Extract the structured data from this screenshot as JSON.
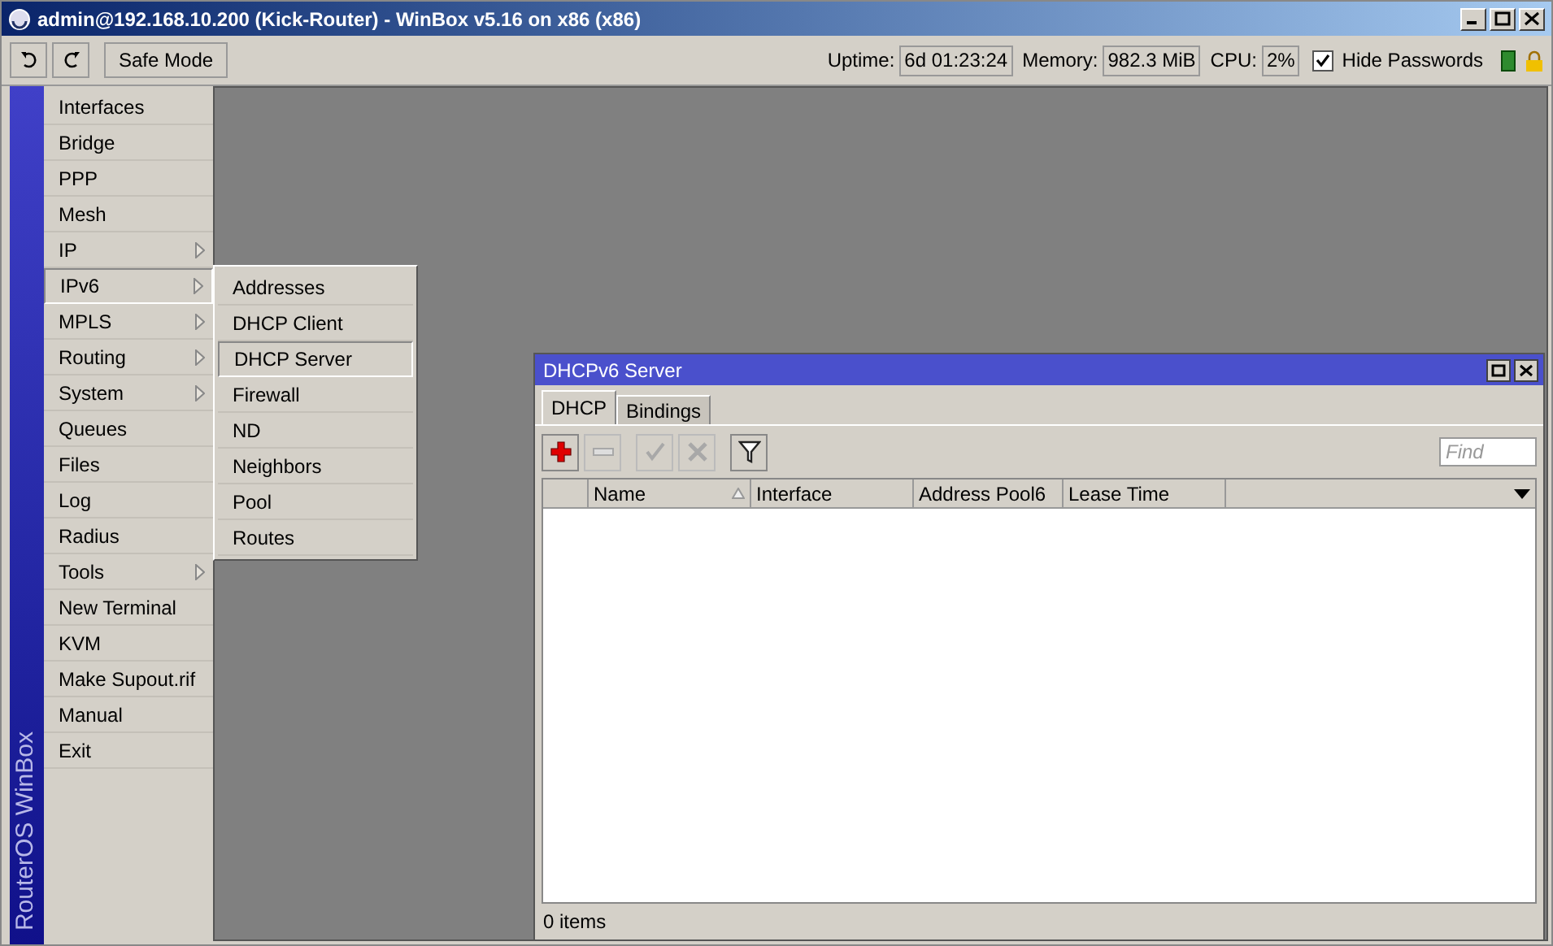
{
  "window": {
    "title": "admin@192.168.10.200 (Kick-Router) - WinBox v5.16 on x86 (x86)"
  },
  "toolbar": {
    "safe_mode": {
      "label": "Safe Mode",
      "on": false
    }
  },
  "status": [
    {
      "label": "Uptime:",
      "value": "6d 01:23:24"
    },
    {
      "label": "Memory:",
      "value": "982.3 MiB"
    },
    {
      "label": "CPU:",
      "value": "2%"
    }
  ],
  "hide_passwords": {
    "label": "Hide Passwords",
    "checked": true
  },
  "sidebar": {
    "brand": "RouterOS WinBox",
    "items": [
      {
        "label": "Interfaces",
        "submenu": false,
        "selected": false
      },
      {
        "label": "Bridge",
        "submenu": false,
        "selected": false
      },
      {
        "label": "PPP",
        "submenu": false,
        "selected": false
      },
      {
        "label": "Mesh",
        "submenu": false,
        "selected": false
      },
      {
        "label": "IP",
        "submenu": true,
        "selected": false
      },
      {
        "label": "IPv6",
        "submenu": true,
        "selected": true
      },
      {
        "label": "MPLS",
        "submenu": true,
        "selected": false
      },
      {
        "label": "Routing",
        "submenu": true,
        "selected": false
      },
      {
        "label": "System",
        "submenu": true,
        "selected": false
      },
      {
        "label": "Queues",
        "submenu": false,
        "selected": false
      },
      {
        "label": "Files",
        "submenu": false,
        "selected": false
      },
      {
        "label": "Log",
        "submenu": false,
        "selected": false
      },
      {
        "label": "Radius",
        "submenu": false,
        "selected": false
      },
      {
        "label": "Tools",
        "submenu": true,
        "selected": false
      },
      {
        "label": "New Terminal",
        "submenu": false,
        "selected": false
      },
      {
        "label": "KVM",
        "submenu": false,
        "selected": false
      },
      {
        "label": "Make Supout.rif",
        "submenu": false,
        "selected": false
      },
      {
        "label": "Manual",
        "submenu": false,
        "selected": false
      },
      {
        "label": "Exit",
        "submenu": false,
        "selected": false
      }
    ]
  },
  "submenu": {
    "items": [
      {
        "label": "Addresses",
        "selected": false
      },
      {
        "label": "DHCP Client",
        "selected": false
      },
      {
        "label": "DHCP Server",
        "selected": true
      },
      {
        "label": "Firewall",
        "selected": false
      },
      {
        "label": "ND",
        "selected": false
      },
      {
        "label": "Neighbors",
        "selected": false
      },
      {
        "label": "Pool",
        "selected": false
      },
      {
        "label": "Routes",
        "selected": false
      }
    ]
  },
  "dhcp_window": {
    "title": "DHCPv6 Server",
    "tabs": [
      {
        "label": "DHCP",
        "selected": true
      },
      {
        "label": "Bindings",
        "selected": false
      }
    ],
    "tools": [
      {
        "kind": "add",
        "disabled": false
      },
      {
        "kind": "remove",
        "disabled": true
      },
      {
        "kind": "enable",
        "disabled": true
      },
      {
        "kind": "disable",
        "disabled": true
      },
      {
        "kind": "filter",
        "disabled": false
      }
    ],
    "find": {
      "placeholder": "Find"
    },
    "columns": [
      {
        "label": "Name",
        "sorted": true
      },
      {
        "label": "Interface",
        "sorted": false
      },
      {
        "label": "Address Pool6",
        "sorted": false
      },
      {
        "label": "Lease Time",
        "sorted": false
      }
    ],
    "status": "0 items"
  }
}
